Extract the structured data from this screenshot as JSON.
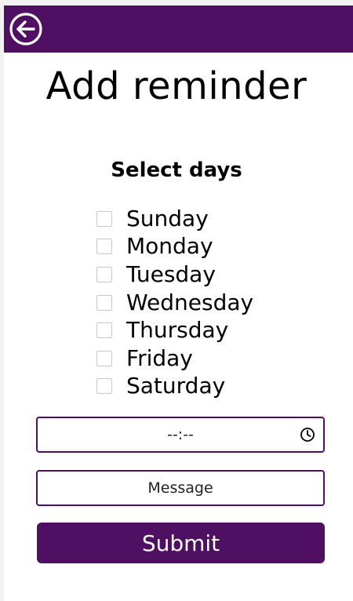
{
  "header": {
    "back_icon": "arrow-left-circle-icon",
    "bar_color": "#4f0f62"
  },
  "title": "Add reminder",
  "days": {
    "heading": "Select days",
    "items": [
      {
        "label": "Sunday",
        "checked": false
      },
      {
        "label": "Monday",
        "checked": false
      },
      {
        "label": "Tuesday",
        "checked": false
      },
      {
        "label": "Wednesday",
        "checked": false
      },
      {
        "label": "Thursday",
        "checked": false
      },
      {
        "label": "Friday",
        "checked": false
      },
      {
        "label": "Saturday",
        "checked": false
      }
    ]
  },
  "time": {
    "value": "--:--",
    "icon": "clock-icon"
  },
  "message": {
    "placeholder": "Message",
    "value": ""
  },
  "submit": {
    "label": "Submit"
  },
  "colors": {
    "accent": "#4f0f62",
    "text": "#000000",
    "background": "#ffffff"
  }
}
